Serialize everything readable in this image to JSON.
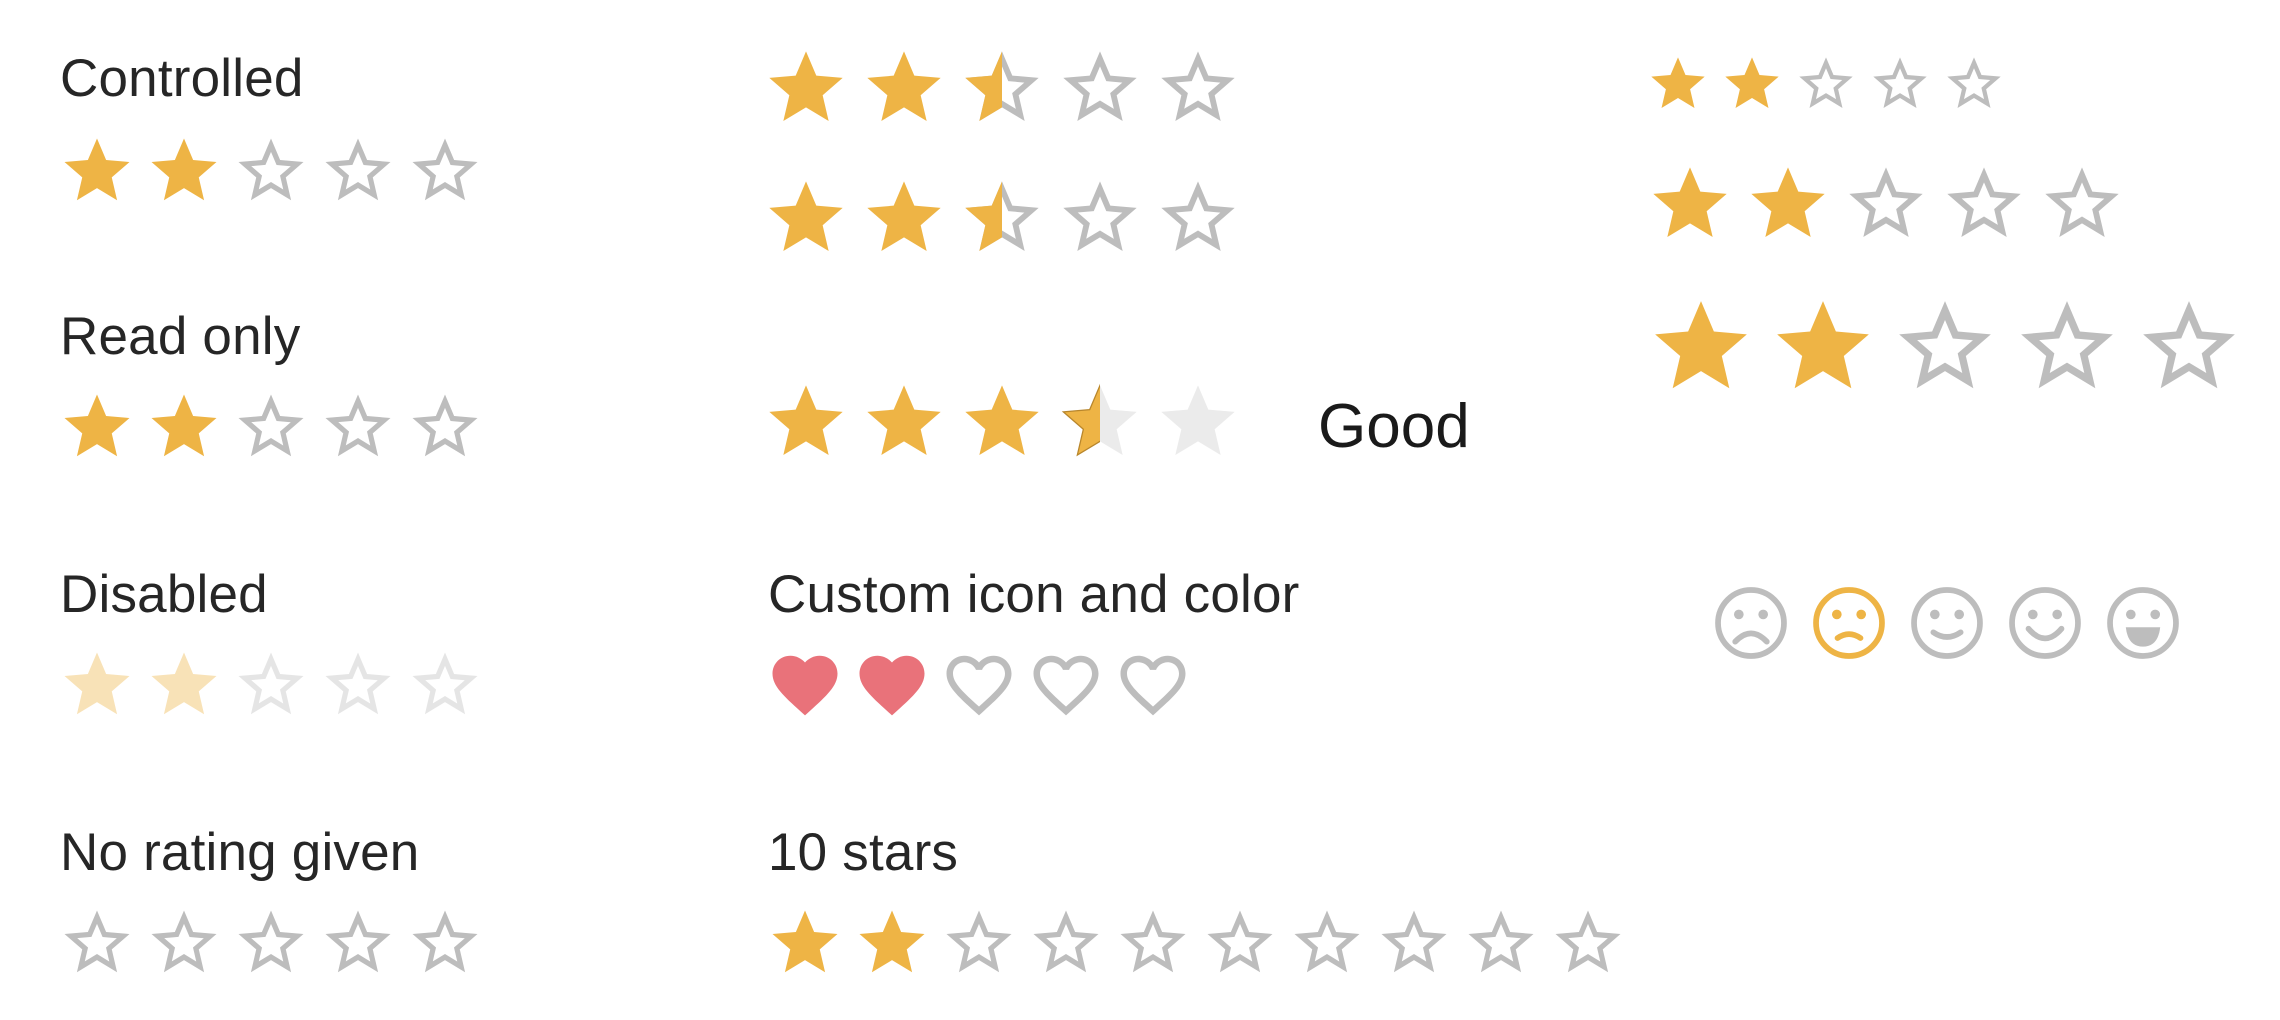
{
  "colors": {
    "star_filled": "#EEB445",
    "star_empty": "#BDBDBD",
    "star_hover_empty": "#EBEBEB",
    "heart_filled": "#E9727A",
    "heart_empty": "#BDBDBD",
    "icon_active": "#EEB445",
    "label_text": "#262626"
  },
  "sections": {
    "controlled": {
      "label": "Controlled",
      "value": 2,
      "max": 5
    },
    "read_only": {
      "label": "Read only",
      "value": 2,
      "max": 5
    },
    "disabled": {
      "label": "Disabled",
      "value": 2,
      "max": 5
    },
    "no_rating": {
      "label": "No rating given",
      "value": 0,
      "max": 5
    },
    "half_rating_1": {
      "value": 2.5,
      "max": 5
    },
    "half_rating_2": {
      "value": 2.5,
      "max": 5
    },
    "hover_feedback": {
      "value": 3.5,
      "max": 5,
      "hover_label": "Good"
    },
    "custom_icon": {
      "label": "Custom icon and color",
      "value": 2,
      "max": 5,
      "icon": "heart-icon"
    },
    "ten_stars": {
      "label": "10 stars",
      "value": 2,
      "max": 10
    },
    "sizes": [
      {
        "size_name": "small",
        "value": 2,
        "max": 5
      },
      {
        "size_name": "medium",
        "value": 2,
        "max": 5
      },
      {
        "size_name": "large",
        "value": 2,
        "max": 5
      }
    ],
    "icon_container": {
      "value": 2,
      "icons": [
        "very-dissatisfied-icon",
        "dissatisfied-icon",
        "neutral-icon",
        "satisfied-icon",
        "very-satisfied-icon"
      ]
    }
  }
}
